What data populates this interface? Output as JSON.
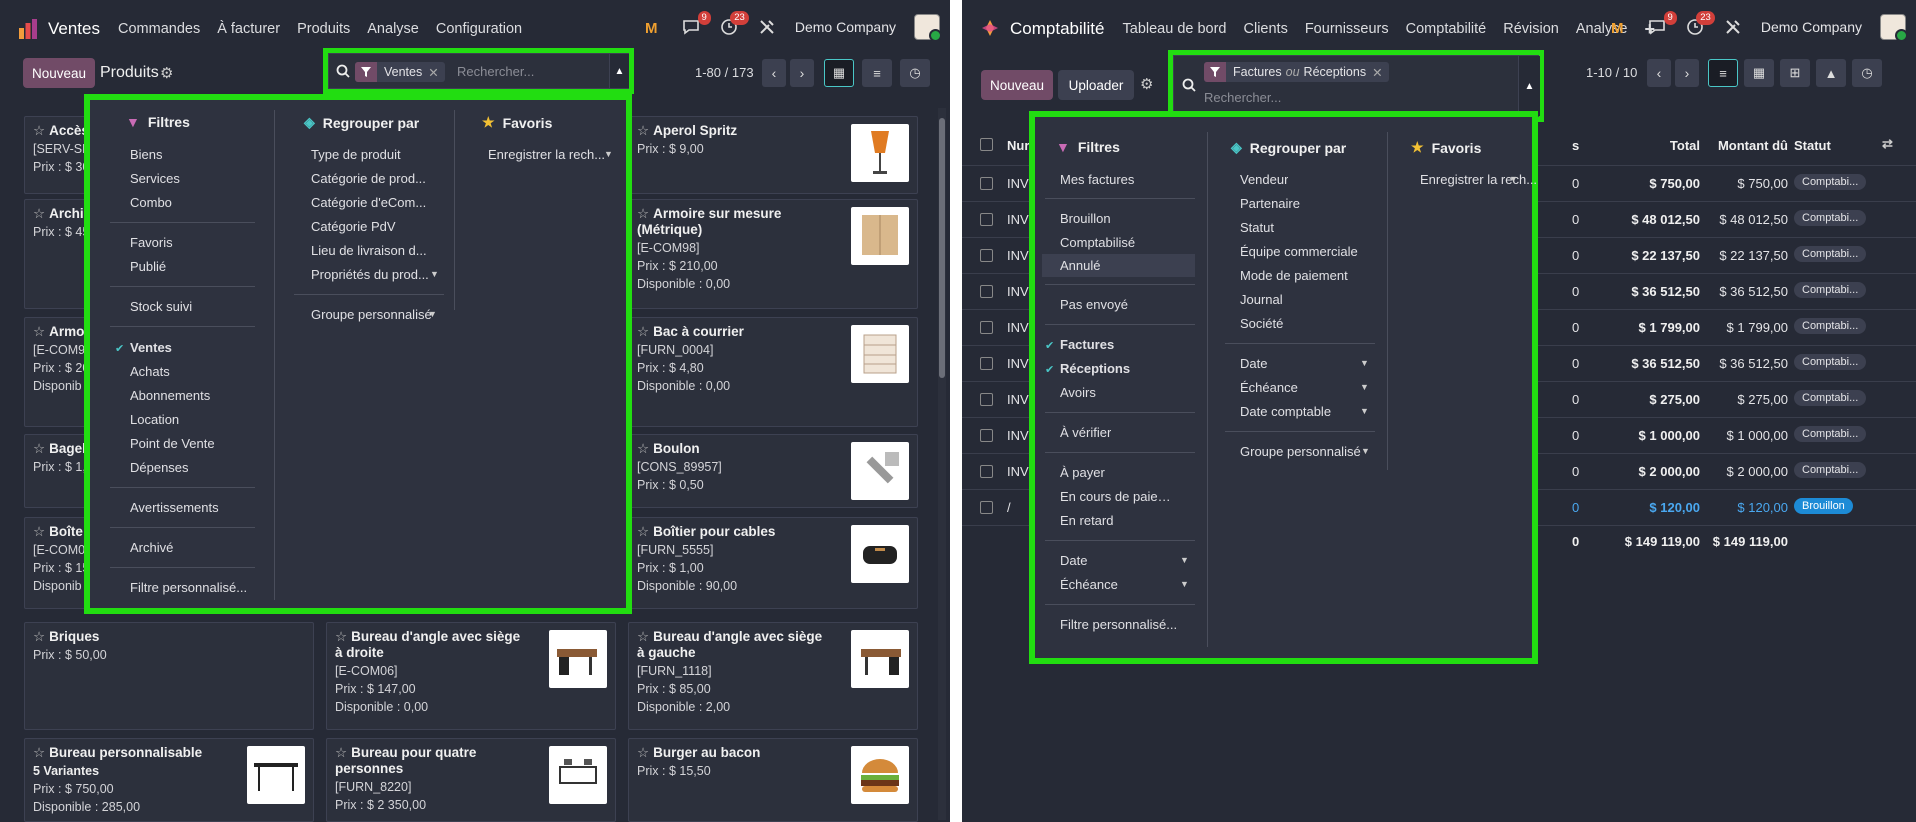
{
  "left": {
    "app_name": "Ventes",
    "menus": [
      "Commandes",
      "À facturer",
      "Produits",
      "Analyse",
      "Configuration"
    ],
    "badges": {
      "chat": "9",
      "activity": "23"
    },
    "company": "Demo Company",
    "new_button": "Nouveau",
    "title": "Produits",
    "search": {
      "facet": "Ventes",
      "placeholder": "Rechercher..."
    },
    "pager": "1-80 / 173",
    "filters": {
      "header": "Filtres",
      "items": [
        "Biens",
        "Services",
        "Combo",
        "Favoris",
        "Publié",
        "Stock suivi",
        "Ventes",
        "Achats",
        "Abonnements",
        "Location",
        "Point de Vente",
        "Dépenses",
        "Avertissements",
        "Archivé",
        "Filtre personnalisé..."
      ]
    },
    "groupby": {
      "header": "Regrouper par",
      "items": [
        "Type de produit",
        "Catégorie de prod...",
        "Catégorie d'eCom...",
        "Catégorie PdV",
        "Lieu de livraison d...",
        "Propriétés du prod...",
        "Groupe personnalisé"
      ]
    },
    "favorites": {
      "header": "Favoris",
      "save": "Enregistrer la rech..."
    },
    "cards": [
      {
        "name": "Accès",
        "lines": [
          "[SERV-SP]",
          "Prix : $ 30"
        ]
      },
      {
        "name": "Archi (mod",
        "lines": [
          "Prix : $ 45"
        ]
      },
      {
        "name": "Armo Unis)",
        "lines": [
          "[E-COM9",
          "Prix : $ 20",
          "Disponib"
        ]
      },
      {
        "name": "Bagel",
        "lines": [
          "Prix : $ 1,"
        ]
      },
      {
        "name": "Boîte",
        "lines": [
          "[E-COM0",
          "Prix : $ 15",
          "Disponib"
        ]
      },
      {
        "name": "Briques",
        "lines": [
          "Prix : $ 50,00"
        ]
      },
      {
        "name": "Bureau personnalisable",
        "lines": [
          "5 Variantes",
          "Prix : $ 750,00",
          "Disponible : 285,00"
        ]
      },
      {
        "name": "Bureau d'angle avec siège à droite",
        "lines": [
          "[E-COM06]",
          "Prix : $ 147,00",
          "Disponible : 0,00"
        ]
      },
      {
        "name": "Bureau pour quatre personnes",
        "lines": [
          "[FURN_8220]",
          "Prix : $ 2 350,00"
        ]
      },
      {
        "name": "Aperol Spritz",
        "lines": [
          "Prix : $ 9,00"
        ]
      },
      {
        "name": "Armoire sur mesure (Métrique)",
        "lines": [
          "[E-COM98]",
          "Prix : $ 210,00",
          "Disponible : 0,00"
        ]
      },
      {
        "name": "Bac à courrier",
        "lines": [
          "[FURN_0004]",
          "Prix : $ 4,80",
          "Disponible : 0,00"
        ]
      },
      {
        "name": "Boulon",
        "lines": [
          "[CONS_89957]",
          "Prix : $ 0,50"
        ]
      },
      {
        "name": "Boîtier pour cables",
        "lines": [
          "[FURN_5555]",
          "Prix : $ 1,00",
          "Disponible : 90,00"
        ]
      },
      {
        "name": "Bureau d'angle avec siège à gauche",
        "lines": [
          "[FURN_1118]",
          "Prix : $ 85,00",
          "Disponible : 2,00"
        ]
      },
      {
        "name": "Burger au bacon",
        "lines": [
          "Prix : $ 15,50"
        ]
      }
    ]
  },
  "right": {
    "app_name": "Comptabilité",
    "menus": [
      "Tableau de bord",
      "Clients",
      "Fournisseurs",
      "Comptabilité",
      "Révision",
      "Analyse"
    ],
    "badges": {
      "chat": "9",
      "activity": "23"
    },
    "company": "Demo Company",
    "new_button": "Nouveau",
    "upload_button": "Uploader",
    "search": {
      "facet_a": "Factures",
      "facet_or": "ou",
      "facet_b": "Réceptions",
      "placeholder": "Rechercher..."
    },
    "pager": "1-10 / 10",
    "filters": {
      "header": "Filtres",
      "items": [
        "Mes factures",
        "Brouillon",
        "Comptabilisé",
        "Annulé",
        "Pas envoyé",
        "Factures",
        "Réceptions",
        "Avoirs",
        "À vérifier",
        "À payer",
        "En cours de paiem...",
        "En retard",
        "Date",
        "Échéance",
        "Filtre personnalisé..."
      ]
    },
    "groupby": {
      "header": "Regrouper par",
      "items": [
        "Vendeur",
        "Partenaire",
        "Statut",
        "Équipe commerciale",
        "Mode de paiement",
        "Journal",
        "Société",
        "Date",
        "Échéance",
        "Date comptable",
        "Groupe personnalisé"
      ]
    },
    "favorites": {
      "header": "Favoris",
      "save": "Enregistrer la rech..."
    },
    "columns": {
      "num": "Nur",
      "s": "s",
      "total": "Total",
      "due": "Montant dû",
      "status": "Statut"
    },
    "rows": [
      {
        "num": "INV",
        "s": "0",
        "total": "$ 750,00",
        "due": "$ 750,00",
        "status": "Comptabi..."
      },
      {
        "num": "INV",
        "s": "0",
        "total": "$ 48 012,50",
        "due": "$ 48 012,50",
        "status": "Comptabi..."
      },
      {
        "num": "INV",
        "s": "0",
        "total": "$ 22 137,50",
        "due": "$ 22 137,50",
        "status": "Comptabi..."
      },
      {
        "num": "INV",
        "s": "0",
        "total": "$ 36 512,50",
        "due": "$ 36 512,50",
        "status": "Comptabi..."
      },
      {
        "num": "INV",
        "s": "0",
        "total": "$ 1 799,00",
        "due": "$ 1 799,00",
        "status": "Comptabi..."
      },
      {
        "num": "INV",
        "s": "0",
        "total": "$ 36 512,50",
        "due": "$ 36 512,50",
        "status": "Comptabi..."
      },
      {
        "num": "INV",
        "s": "0",
        "total": "$ 275,00",
        "due": "$ 275,00",
        "status": "Comptabi..."
      },
      {
        "num": "INV",
        "s": "0",
        "total": "$ 1 000,00",
        "due": "$ 1 000,00",
        "status": "Comptabi..."
      },
      {
        "num": "INV",
        "s": "0",
        "total": "$ 2 000,00",
        "due": "$ 2 000,00",
        "status": "Comptabi..."
      },
      {
        "num": "/",
        "s": "0",
        "total": "$ 120,00",
        "due": "$ 120,00",
        "status": "Brouillon"
      }
    ],
    "totals": {
      "s": "0",
      "total": "$ 149 119,00",
      "due": "$ 149 119,00"
    }
  }
}
